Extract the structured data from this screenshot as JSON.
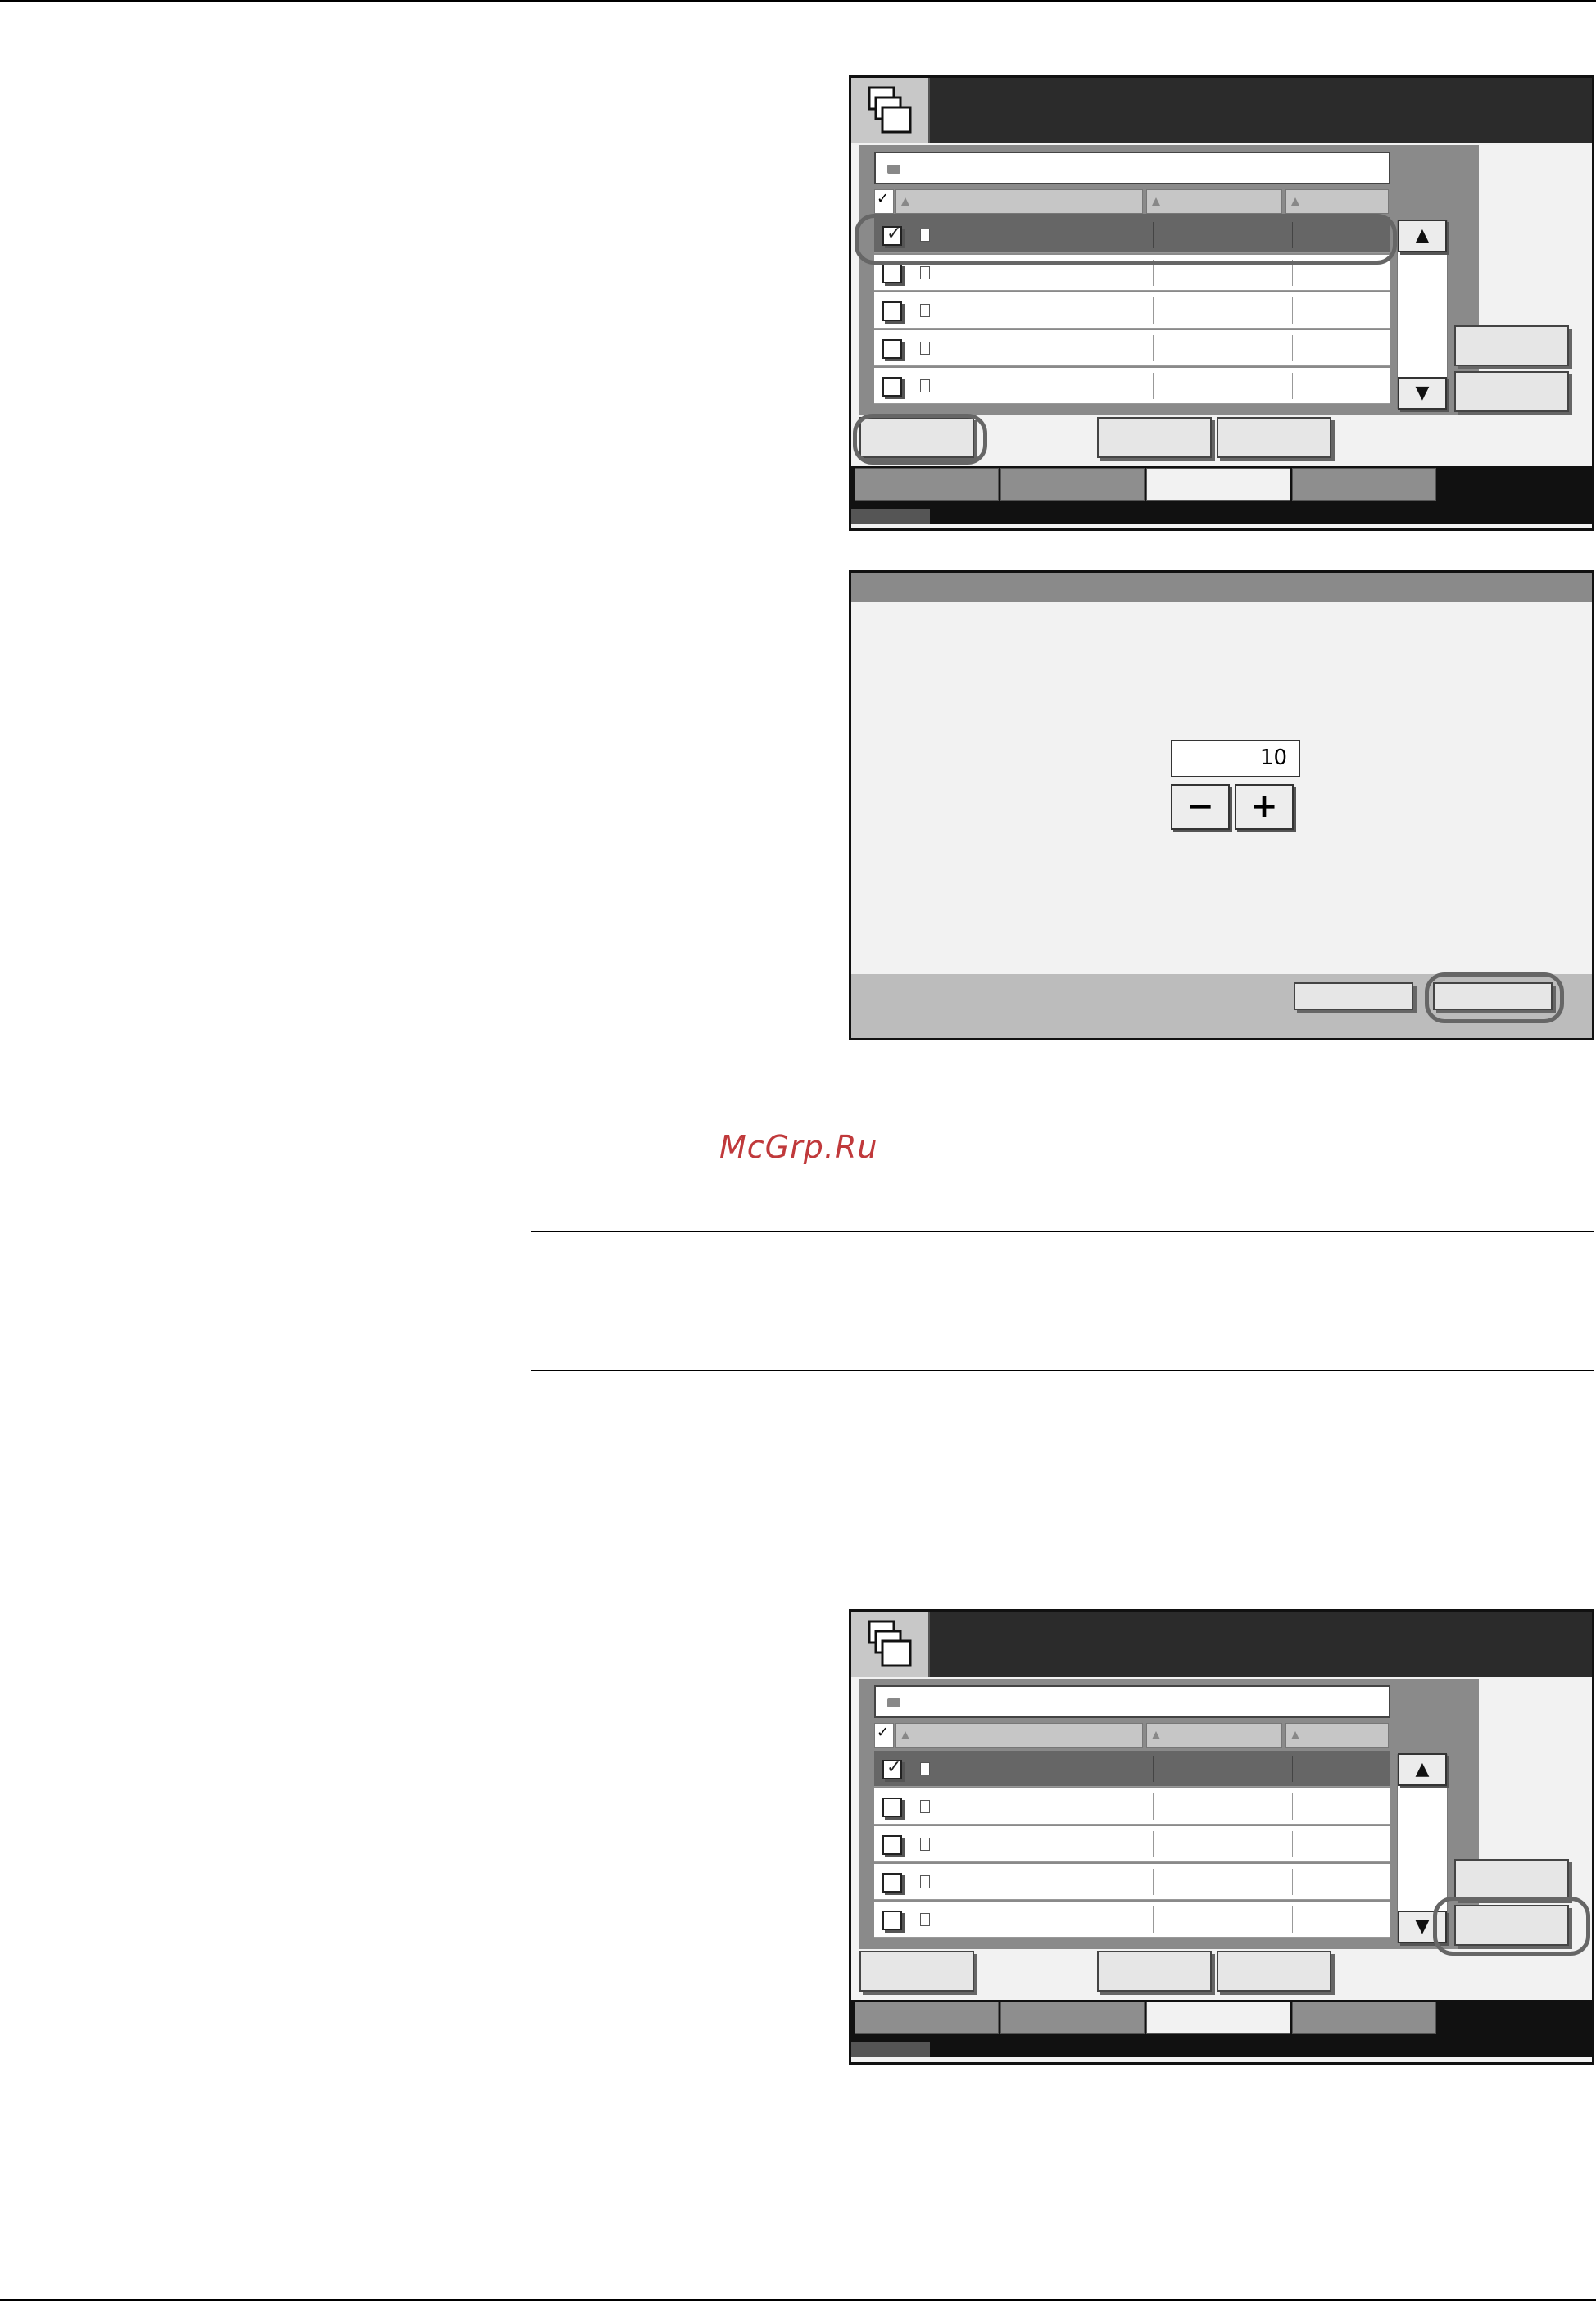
{
  "watermark": {
    "text": "McGrp.Ru"
  },
  "dialog": {
    "quantity_value": "10",
    "minus_symbol": "−",
    "plus_symbol": "+"
  },
  "scroll": {
    "up_symbol": "▲",
    "down_symbol": "▼"
  },
  "colors": {
    "titlebar": "#2b2b2b",
    "selected_row": "#666666",
    "callout": "#666666",
    "watermark": "#c0393b"
  }
}
